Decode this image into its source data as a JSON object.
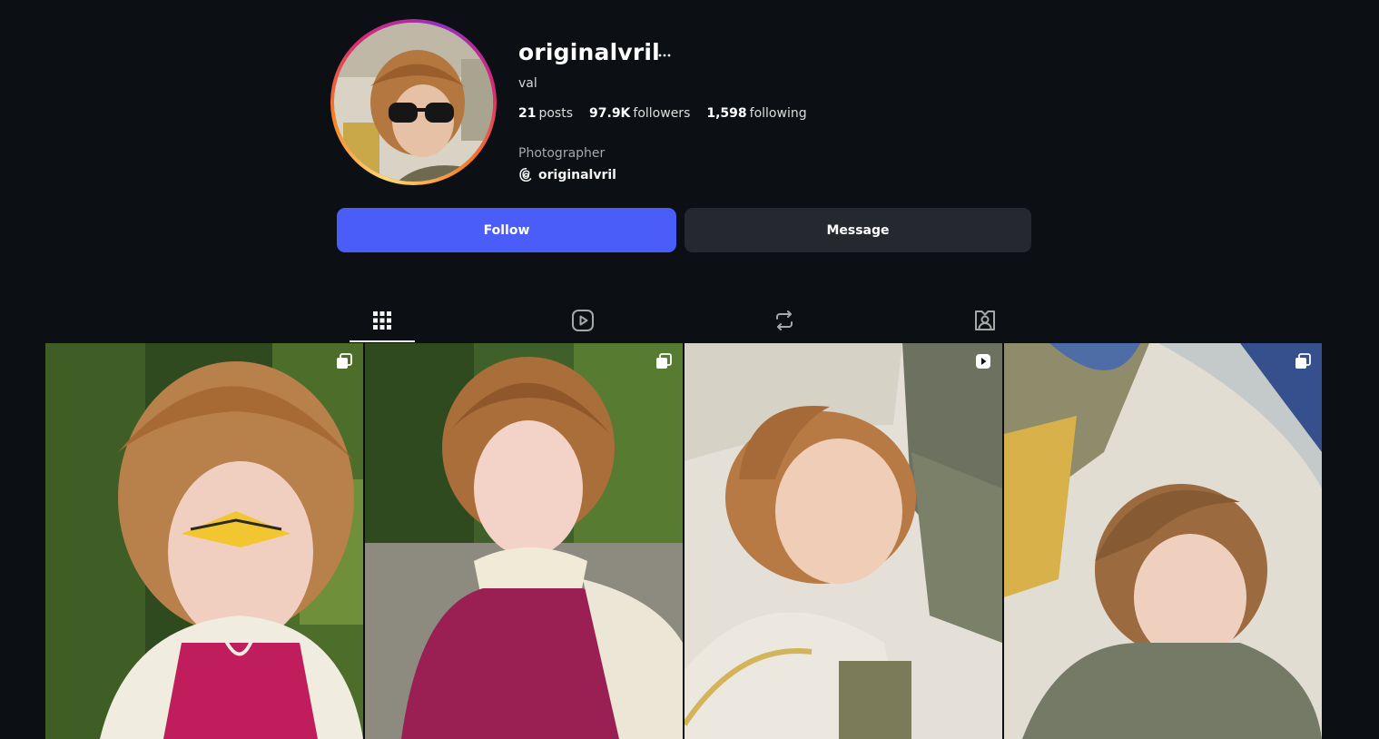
{
  "profile": {
    "username": "originalvril",
    "more_label": "···",
    "full_name": "val",
    "stats": {
      "posts_count": "21",
      "posts_label": "posts",
      "followers_count": "97.9K",
      "followers_label": "followers",
      "following_count": "1,598",
      "following_label": "following"
    },
    "category": "Photographer",
    "threads_handle": "originalvril"
  },
  "actions": {
    "follow_label": "Follow",
    "message_label": "Message"
  },
  "tabs": [
    {
      "icon": "grid-icon",
      "active": true
    },
    {
      "icon": "reels-icon",
      "active": false
    },
    {
      "icon": "reposts-icon",
      "active": false
    },
    {
      "icon": "tagged-icon",
      "active": false
    }
  ],
  "posts": [
    {
      "type": "carousel",
      "badge_icon": "carousel-icon"
    },
    {
      "type": "carousel",
      "badge_icon": "carousel-icon"
    },
    {
      "type": "reel",
      "badge_icon": "reel-icon"
    },
    {
      "type": "carousel",
      "badge_icon": "carousel-icon"
    }
  ],
  "colors": {
    "background": "#0c0f14",
    "follow_button": "#4a5df9",
    "message_button": "#25282e"
  }
}
